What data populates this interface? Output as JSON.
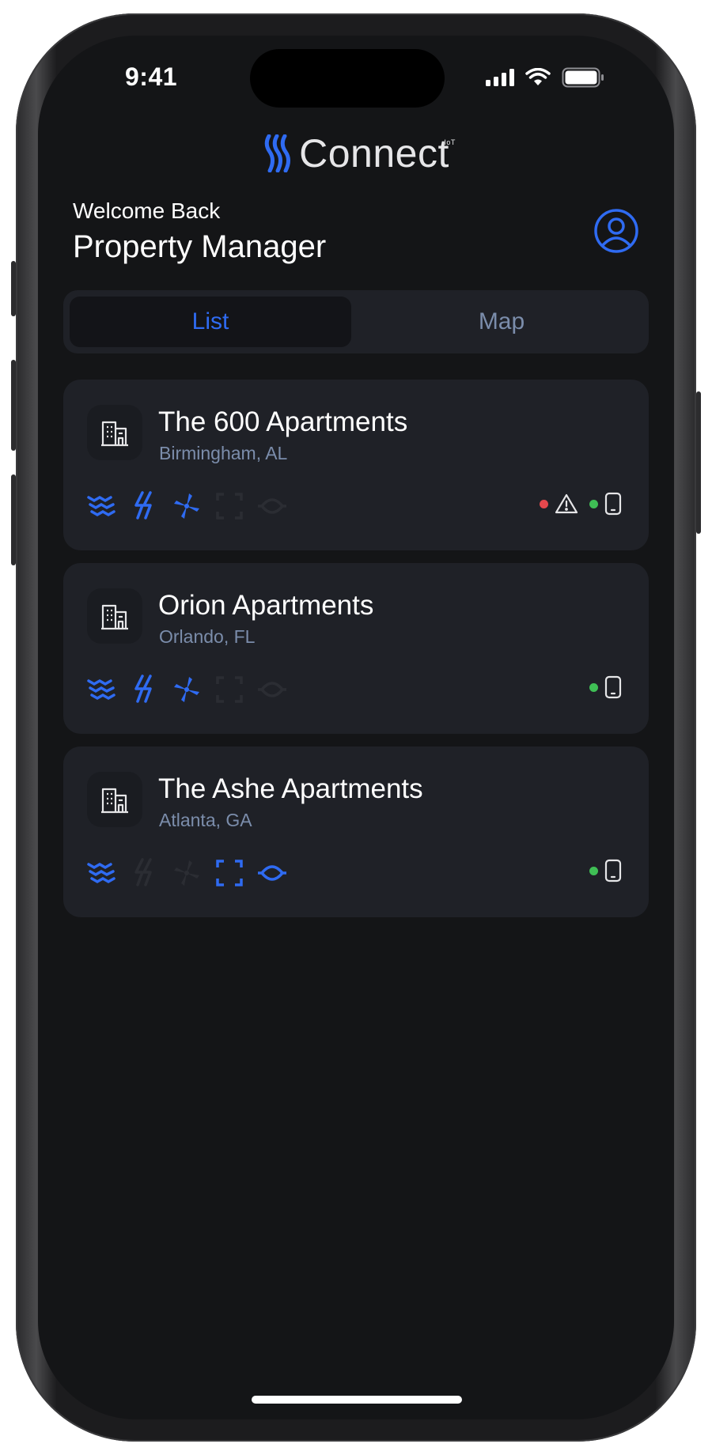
{
  "status_bar": {
    "time": "9:41"
  },
  "app": {
    "logo_text": "Connect",
    "logo_superscript": "IoT"
  },
  "header": {
    "greeting": "Welcome Back",
    "user_role": "Property Manager"
  },
  "view_toggle": {
    "tabs": [
      {
        "label": "List",
        "selected": true
      },
      {
        "label": "Map",
        "selected": false
      }
    ]
  },
  "properties": [
    {
      "name": "The 600 Apartments",
      "location": "Birmingham, AL",
      "features": {
        "water": true,
        "power": true,
        "hvac": true,
        "access": false,
        "sensor": false
      },
      "status": {
        "alert": true,
        "device_online": true
      }
    },
    {
      "name": "Orion Apartments",
      "location": "Orlando, FL",
      "features": {
        "water": true,
        "power": true,
        "hvac": true,
        "access": false,
        "sensor": false
      },
      "status": {
        "alert": false,
        "device_online": true
      }
    },
    {
      "name": "The Ashe Apartments",
      "location": "Atlanta, GA",
      "features": {
        "water": true,
        "power": false,
        "hvac": false,
        "access": true,
        "sensor": true
      },
      "status": {
        "alert": false,
        "device_online": true
      }
    }
  ],
  "icons": {
    "building": "building-icon",
    "water": "water-waves-icon",
    "power": "lightning-icon",
    "hvac": "fan-icon",
    "access": "scan-frame-icon",
    "sensor": "sensor-ring-icon",
    "alert": "warning-triangle-icon",
    "device": "phone-icon",
    "profile": "user-circle-icon"
  },
  "colors": {
    "accent": "#2f6bf2",
    "inactive_icon": "#2b2d33",
    "alert_dot": "#e5484d",
    "online_dot": "#3fbf55",
    "background": "#141517",
    "card": "#1f2127"
  }
}
